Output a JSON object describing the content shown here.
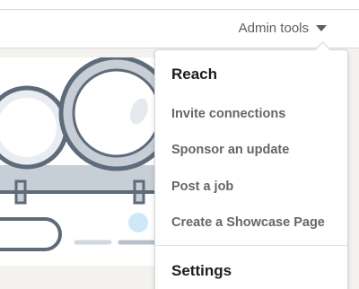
{
  "header": {
    "admin_tools_label": "Admin tools"
  },
  "menu": {
    "reach_title": "Reach",
    "reach_items": [
      {
        "label": "Invite connections"
      },
      {
        "label": "Sponsor an update"
      },
      {
        "label": "Post a job"
      },
      {
        "label": "Create a Showcase Page"
      }
    ],
    "settings_title": "Settings"
  },
  "colors": {
    "illustration_outline": "#5e6b7a",
    "illustration_fill": "#c7ced6",
    "illustration_accent": "#cfe8f8"
  }
}
